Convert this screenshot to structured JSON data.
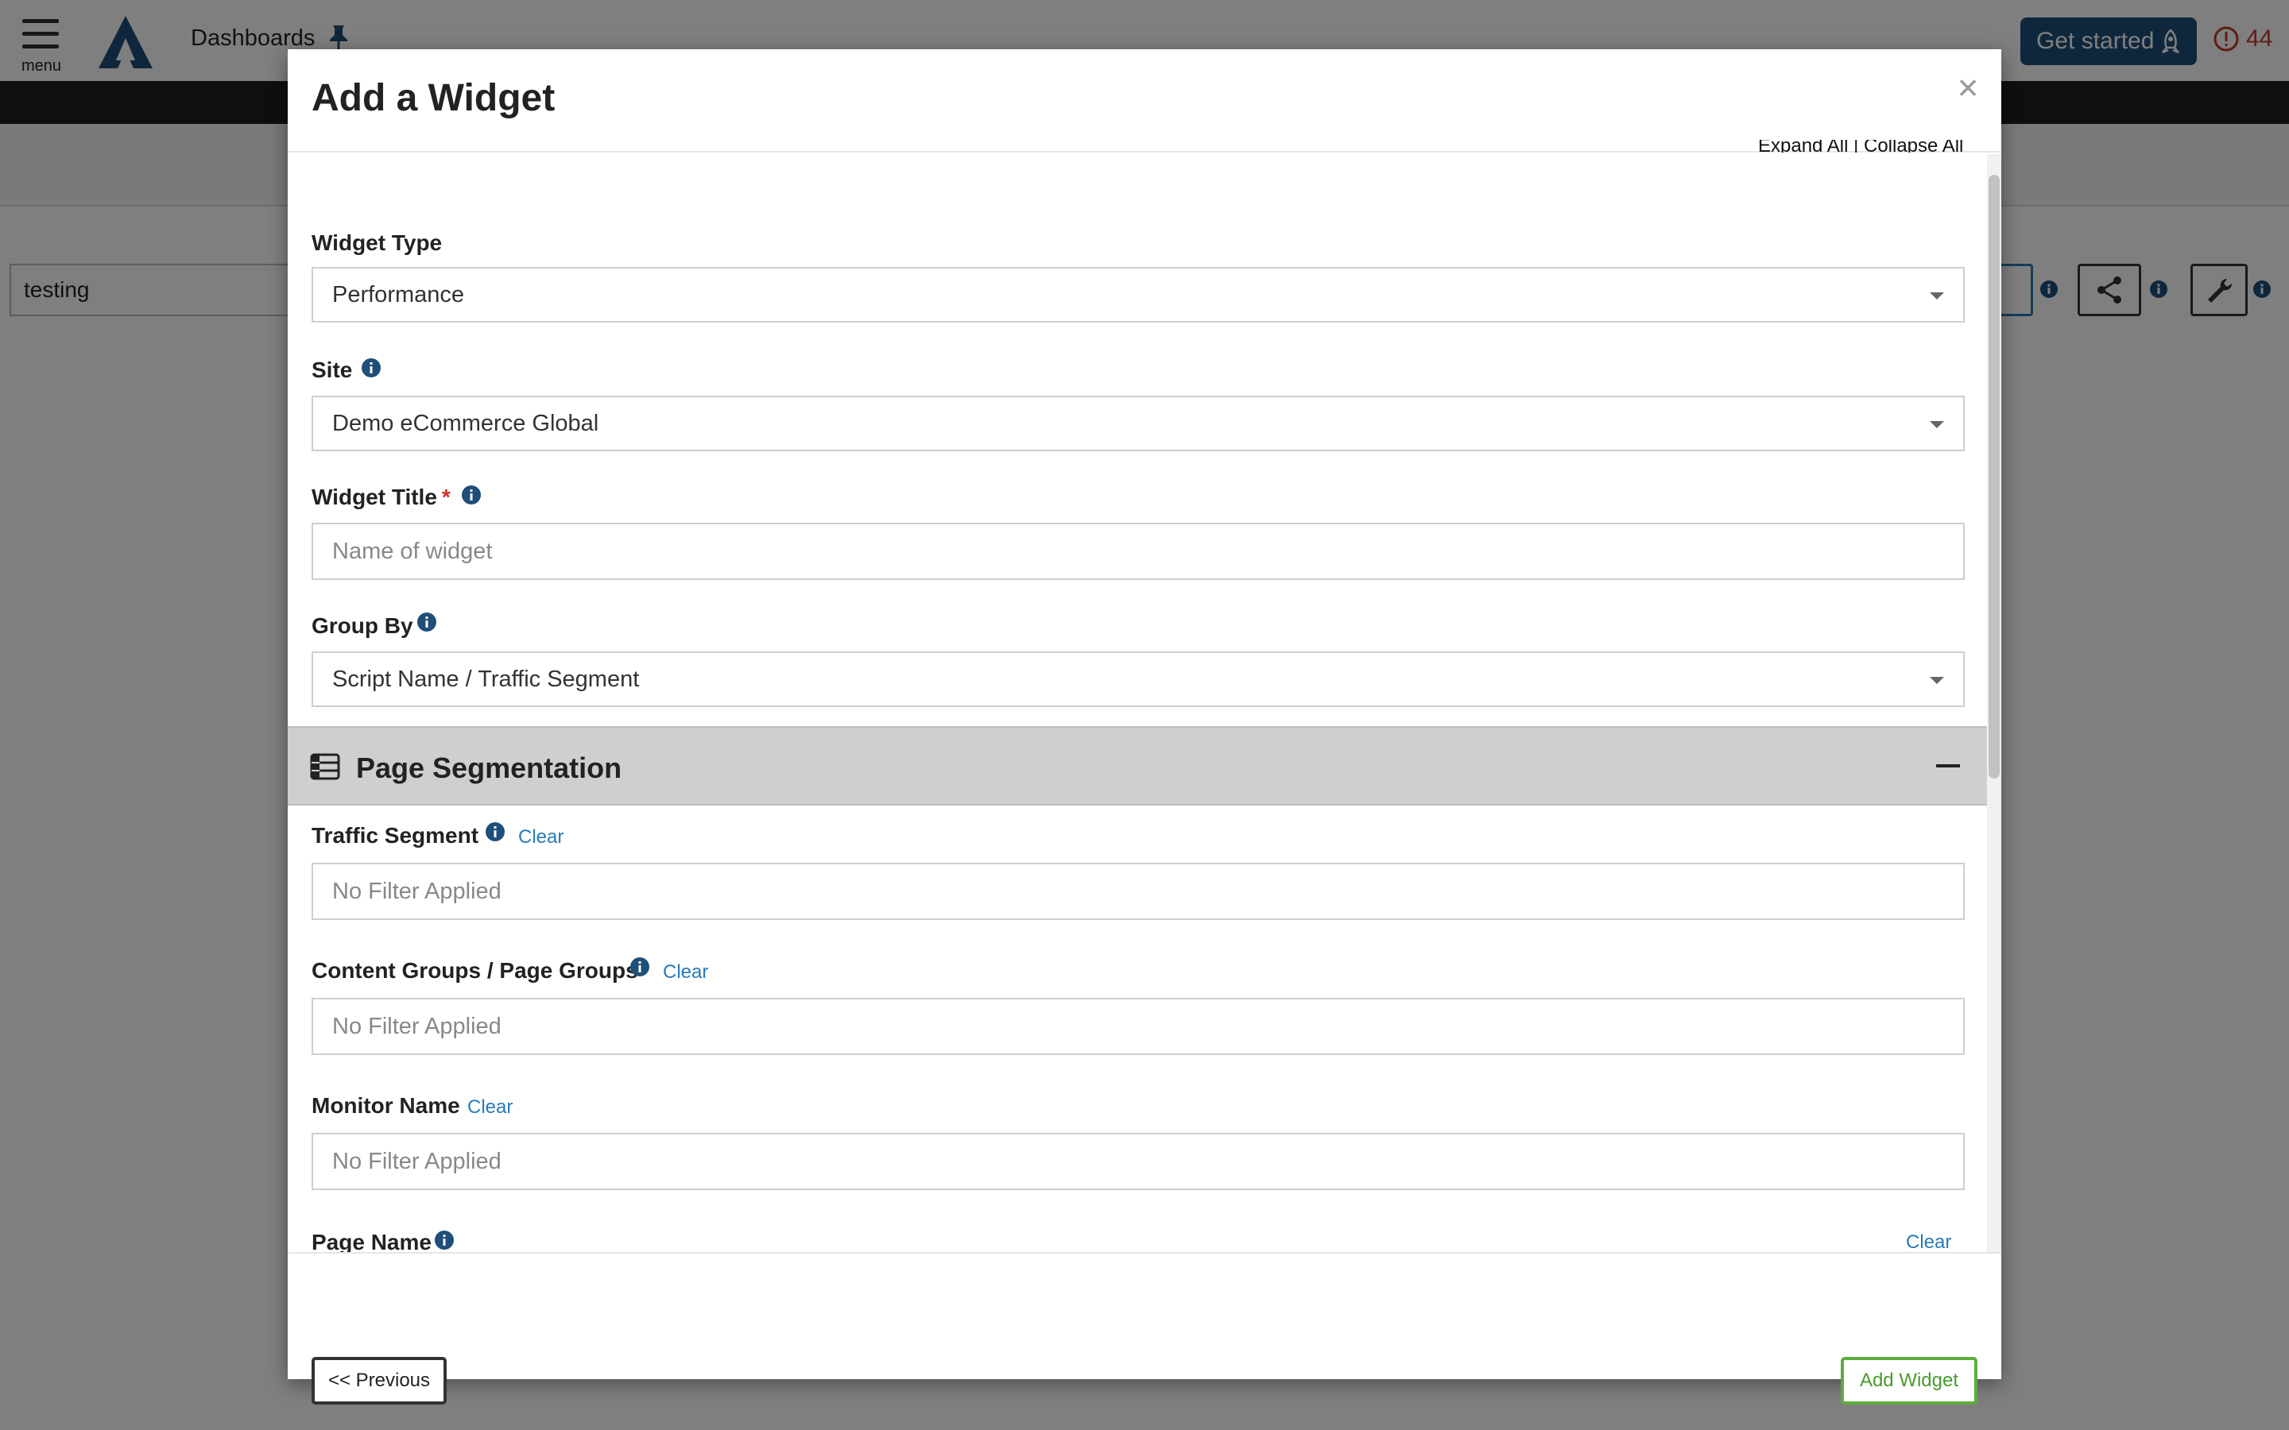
{
  "header": {
    "menu_label": "menu",
    "breadcrumb": "Dashboards",
    "get_started_label": "Get started",
    "alert_count": "44"
  },
  "filter_bar": {
    "search_value": "testing"
  },
  "modal": {
    "title": "Add a Widget",
    "close_glyph": "×",
    "expand_collapse": "Expand All | Collapse All",
    "fields": {
      "widget_type": {
        "label": "Widget Type",
        "value": "Performance"
      },
      "site": {
        "label": "Site",
        "value": "Demo eCommerce Global"
      },
      "widget_title": {
        "label": "Widget Title",
        "required_mark": "*",
        "placeholder": "Name of widget"
      },
      "group_by": {
        "label": "Group By",
        "value": "Script Name / Traffic Segment"
      }
    },
    "section": {
      "title": "Page Segmentation",
      "filters": {
        "traffic_segment": {
          "label": "Traffic Segment",
          "clear": "Clear",
          "placeholder": "No Filter Applied"
        },
        "content_groups": {
          "label": "Content Groups / Page Groups",
          "clear": "Clear",
          "placeholder": "No Filter Applied"
        },
        "monitor_name": {
          "label": "Monitor Name",
          "clear": "Clear",
          "placeholder": "No Filter Applied"
        },
        "page_name": {
          "label": "Page Name",
          "clear": "Clear"
        }
      }
    },
    "footer": {
      "previous_label": "<< Previous",
      "add_label": "Add Widget"
    }
  },
  "colors": {
    "brand_dark": "#1f4e79",
    "info_icon": "#1f4e79",
    "link": "#2a7ab8",
    "required": "#d32f2f",
    "add_button": "#5cae3b",
    "alert": "#c0392b"
  },
  "icons": [
    "menu-icon",
    "logo-icon",
    "pin-icon",
    "rocket-icon",
    "alert-icon",
    "close-icon",
    "info-icon",
    "table-icon",
    "collapse-icon",
    "share-icon",
    "wrench-icon",
    "film-icon",
    "help-icon",
    "gear-icon",
    "user-icon",
    "caret-down-icon"
  ]
}
